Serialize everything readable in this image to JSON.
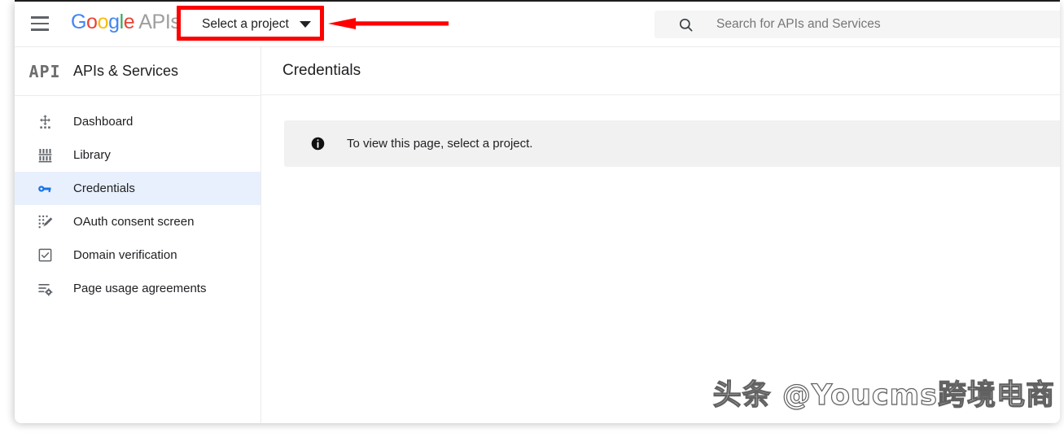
{
  "topbar": {
    "menu_icon": "hamburger-menu-icon",
    "brand": {
      "g1": "G",
      "o1": "o",
      "o2": "o",
      "g2": "g",
      "l1": "l",
      "e1": "e",
      "suffix": "APIs"
    },
    "project_selector": {
      "label": "Select a project",
      "caret_icon": "chevron-down-icon"
    },
    "search": {
      "icon": "search-icon",
      "placeholder": "Search for APIs and Services",
      "value": ""
    }
  },
  "annotation": {
    "box_color": "#fe0000",
    "arrow_color": "#fe0000",
    "target": "Select a project"
  },
  "sidebar": {
    "logo_text": "API",
    "title": "APIs & Services",
    "items": [
      {
        "label": "Dashboard",
        "icon": "dashboard-icon",
        "active": false
      },
      {
        "label": "Library",
        "icon": "library-icon",
        "active": false
      },
      {
        "label": "Credentials",
        "icon": "key-icon",
        "active": true
      },
      {
        "label": "OAuth consent screen",
        "icon": "oauth-consent-icon",
        "active": false
      },
      {
        "label": "Domain verification",
        "icon": "checkbox-check-icon",
        "active": false
      },
      {
        "label": "Page usage agreements",
        "icon": "list-settings-icon",
        "active": false
      }
    ],
    "active_bg": "#e8f0fe",
    "active_icon_color": "#1a73e8"
  },
  "main": {
    "title": "Credentials",
    "banner": {
      "icon": "info-icon",
      "text": "To view this page, select a project."
    }
  },
  "watermark": {
    "text": "头条 @Youcms跨境电商"
  }
}
